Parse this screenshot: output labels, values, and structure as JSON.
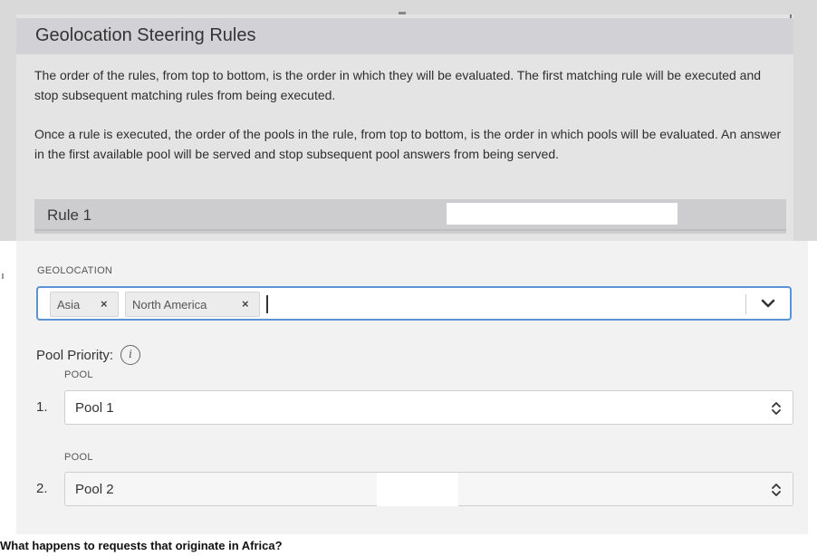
{
  "dialog": {
    "title": "Geolocation Steering Rules",
    "paragraph_1": "The order of the rules, from top to bottom, is the order in which they will be evaluated. The first matching rule will be executed and stop subsequent matching rules from being executed.",
    "paragraph_2": "Once a rule is executed, the order of the pools in the rule, from top to bottom, is the order in which pools will be evaluated. An answer in the first available pool will be served and stop subsequent pool answers from being served."
  },
  "rule": {
    "label": "Rule 1"
  },
  "geolocation": {
    "label": "GEOLOCATION",
    "chips": [
      {
        "label": "Asia",
        "remove": "×"
      },
      {
        "label": "North America",
        "remove": "×"
      }
    ],
    "dropdown_icon": "chevron-down-icon"
  },
  "pool_priority": {
    "label": "Pool Priority:",
    "info_icon": "i"
  },
  "pools": [
    {
      "number": "1.",
      "field_label": "POOL",
      "value": "Pool 1",
      "icon": "updown-arrows-icon"
    },
    {
      "number": "2.",
      "field_label": "POOL",
      "value": "Pool 2",
      "icon": "updown-arrows-icon"
    }
  ],
  "question": "What happens to requests that originate in Africa?",
  "colors": {
    "focus_border": "#5b93d6",
    "header_bg": "#d2d2d6",
    "card_bg": "#f2f2f3"
  }
}
